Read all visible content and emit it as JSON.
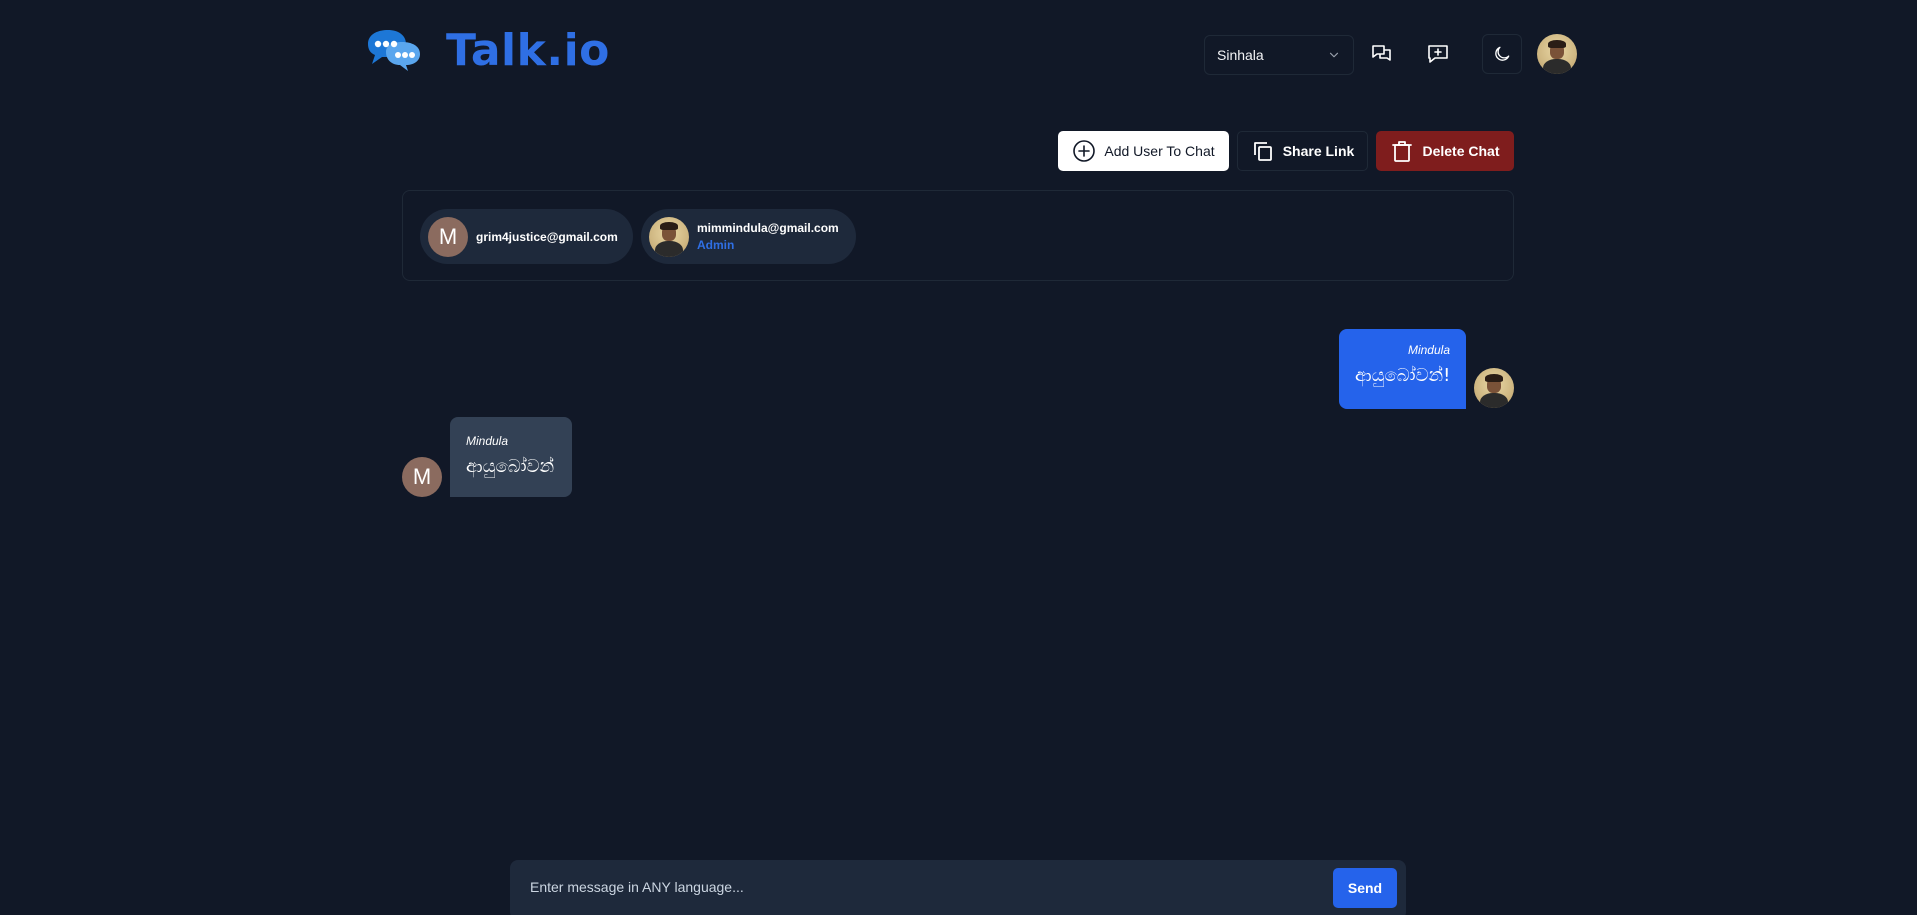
{
  "header": {
    "app_name": "Talk.io",
    "language": {
      "selected": "Sinhala"
    },
    "icons": {
      "chats": "chat-bubbles-icon",
      "new_chat": "message-plus-icon",
      "theme": "moon-icon"
    }
  },
  "actions": {
    "add_user_label": "Add User To Chat",
    "share_link_label": "Share Link",
    "delete_chat_label": "Delete Chat"
  },
  "participants": [
    {
      "avatar_letter": "M",
      "email": "grim4justice@gmail.com",
      "role": ""
    },
    {
      "avatar_letter": "",
      "email": "mimmindula@gmail.com",
      "role": "Admin"
    }
  ],
  "messages": [
    {
      "side": "right",
      "sender": "Mindula",
      "text": "ආයුබෝවන්!"
    },
    {
      "side": "left",
      "sender": "Mindula",
      "text": "ආයුබෝවන්",
      "avatar_letter": "M"
    }
  ],
  "composer": {
    "placeholder": "Enter message in ANY language...",
    "send_label": "Send"
  },
  "colors": {
    "background": "#111827",
    "brand": "#2f6fe4",
    "primary": "#2563eb",
    "danger": "#7f1d1d",
    "received_bubble": "#334155",
    "panel": "#1e293b"
  }
}
